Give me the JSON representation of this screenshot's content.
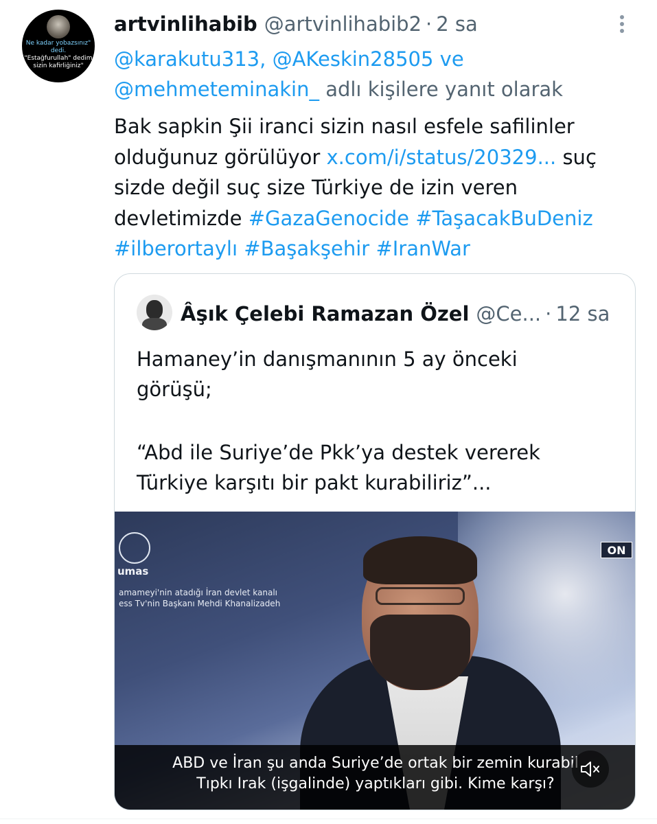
{
  "tweet": {
    "author_name": "artvinlihabib",
    "author_handle": "@artvinlihabib2",
    "separator": "·",
    "time": "2 sa",
    "avatar_text_1": "Ne kadar yobazsınız\" dedi.",
    "avatar_text_2": "\"Estağfurullah\" dedim sizin kafirliğiniz\"",
    "reply_to": {
      "mention_1": "@karakutu313,",
      "mention_2": "@AKeskin28505",
      "and": "ve",
      "mention_3": "@mehmeteminakin_",
      "suffix": "adlı kişilere yanıt olarak"
    },
    "body": {
      "line1": "Bak sapkin Şii iranci sizin nasıl esfele safilinler",
      "line2_text": "olduğunuz görülüyor",
      "line2_link": "x.com/i/status/20329...",
      "line2_tail": "suç",
      "line3": "sizde değil suç size Türkiye de izin veren",
      "line4_text": "devletimizde",
      "hashtag_1": "#GazaGenocide",
      "hashtag_2": "#TaşacakBuDeniz",
      "hashtag_3": "#ilberortaylı",
      "hashtag_4": "#Başakşehir",
      "hashtag_5": "#IranWar"
    }
  },
  "quote": {
    "author_name": "Âşık Çelebi Ramazan Özel",
    "author_handle": "@Ce...",
    "separator": "·",
    "time": "12 sa",
    "text_line1": "Hamaney’in danışmanının 5 ay önceki",
    "text_line2": "görüşü;",
    "text_line3": "“Abd ile Suriye’de Pkk’ya destek vererek",
    "text_line4": "Türkiye karşıtı bir pakt kurabiliriz”...",
    "video": {
      "logo_word": "umas",
      "caption_line1": "amameyi'nin atadığı İran devlet kanalı",
      "caption_line2": "ess Tv'nin Başkanı Mehdi Khanalizadeh",
      "channel_logo": "ON",
      "subtitle_line1": "ABD ve İran şu anda Suriye’de ortak bir zemin kurabil",
      "subtitle_line2": "Tıpkı Irak (işgalinde) yaptıkları gibi. Kime karşı?",
      "mute_icon": "speaker-muted-icon"
    }
  },
  "colors": {
    "link": "#1d9bf0",
    "secondary_text": "#536471",
    "primary_text": "#0f1419",
    "border": "#cfd9de"
  }
}
